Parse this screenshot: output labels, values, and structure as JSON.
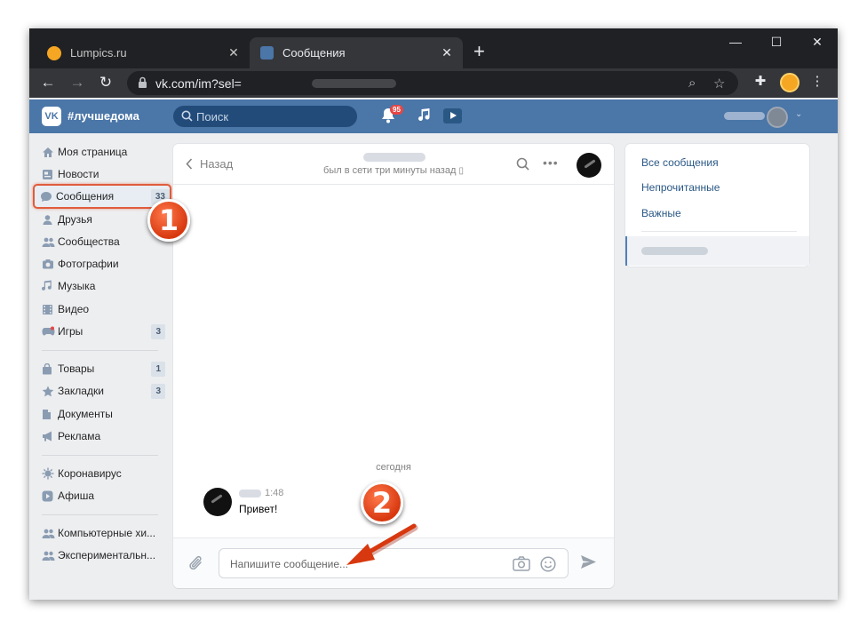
{
  "browser": {
    "tabs": [
      {
        "title": "Lumpics.ru",
        "active": false,
        "favicon_color": "#f5a623"
      },
      {
        "title": "Сообщения",
        "active": true,
        "favicon_color": "#4a76a8"
      }
    ],
    "url": "vk.com/im?sel=",
    "window_controls": {
      "minimize": "—",
      "maximize": "☐",
      "close": "✕"
    }
  },
  "vk": {
    "logo": "VK",
    "hashtag": "#лучшедома",
    "search_placeholder": "Поиск",
    "notifications_count": "95"
  },
  "leftnav": {
    "items": [
      {
        "label": "Моя страница",
        "icon": "home-icon"
      },
      {
        "label": "Новости",
        "icon": "news-icon"
      },
      {
        "label": "Сообщения",
        "icon": "messages-icon",
        "badge": "33",
        "selected": true
      },
      {
        "label": "Друзья",
        "icon": "friends-icon"
      },
      {
        "label": "Сообщества",
        "icon": "groups-icon"
      },
      {
        "label": "Фотографии",
        "icon": "camera-icon"
      },
      {
        "label": "Музыка",
        "icon": "music-icon"
      },
      {
        "label": "Видео",
        "icon": "video-icon"
      },
      {
        "label": "Игры",
        "icon": "gamepad-icon",
        "badge": "3"
      },
      {
        "label": "Товары",
        "icon": "shopping-bag-icon",
        "badge": "1"
      },
      {
        "label": "Закладки",
        "icon": "star-icon",
        "badge": "3"
      },
      {
        "label": "Документы",
        "icon": "document-icon"
      },
      {
        "label": "Реклама",
        "icon": "megaphone-icon"
      },
      {
        "label": "Коронавирус",
        "icon": "virus-icon"
      },
      {
        "label": "Афиша",
        "icon": "play-icon"
      },
      {
        "label": "Компьютерные хи...",
        "icon": "group-icon"
      },
      {
        "label": "Экспериментальн...",
        "icon": "group-icon"
      }
    ]
  },
  "chat": {
    "back_label": "Назад",
    "status": "был в сети три минуты назад",
    "day_divider": "сегодня",
    "messages": [
      {
        "time": "1:48",
        "text": "Привет!"
      }
    ],
    "input_placeholder": "Напишите сообщение..."
  },
  "rightpanel": {
    "filters": [
      "Все сообщения",
      "Непрочитанные",
      "Важные"
    ]
  },
  "annotations": {
    "step1": "1",
    "step2": "2",
    "color": "#d8380f"
  }
}
